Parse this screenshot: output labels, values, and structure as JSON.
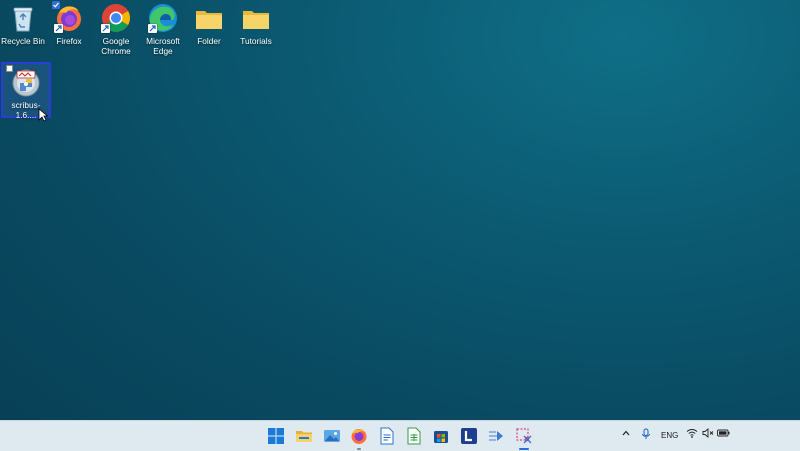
{
  "desktop": {
    "icons": [
      {
        "label": "Recycle Bin"
      },
      {
        "label": "Firefox"
      },
      {
        "label": "Google Chrome"
      },
      {
        "label": "Microsoft Edge"
      },
      {
        "label": "Folder"
      },
      {
        "label": "Tutorials"
      },
      {
        "label": "scribus-1.6...."
      }
    ]
  },
  "taskbar": {
    "apps": [
      {
        "icon": "windows-start-icon"
      },
      {
        "icon": "file-explorer-icon"
      },
      {
        "icon": "photos-icon"
      },
      {
        "icon": "firefox-icon"
      },
      {
        "icon": "writer-document-icon"
      },
      {
        "icon": "spreadsheet-icon"
      },
      {
        "icon": "microsoft-store-icon"
      },
      {
        "icon": "l-app-icon"
      },
      {
        "icon": "arrow-app-icon"
      },
      {
        "icon": "snipping-tool-icon"
      }
    ],
    "tray": {
      "language": "ENG"
    }
  },
  "colors": {
    "accent": "#2a3dd8",
    "taskbar_bg": "#dfe9f0"
  }
}
